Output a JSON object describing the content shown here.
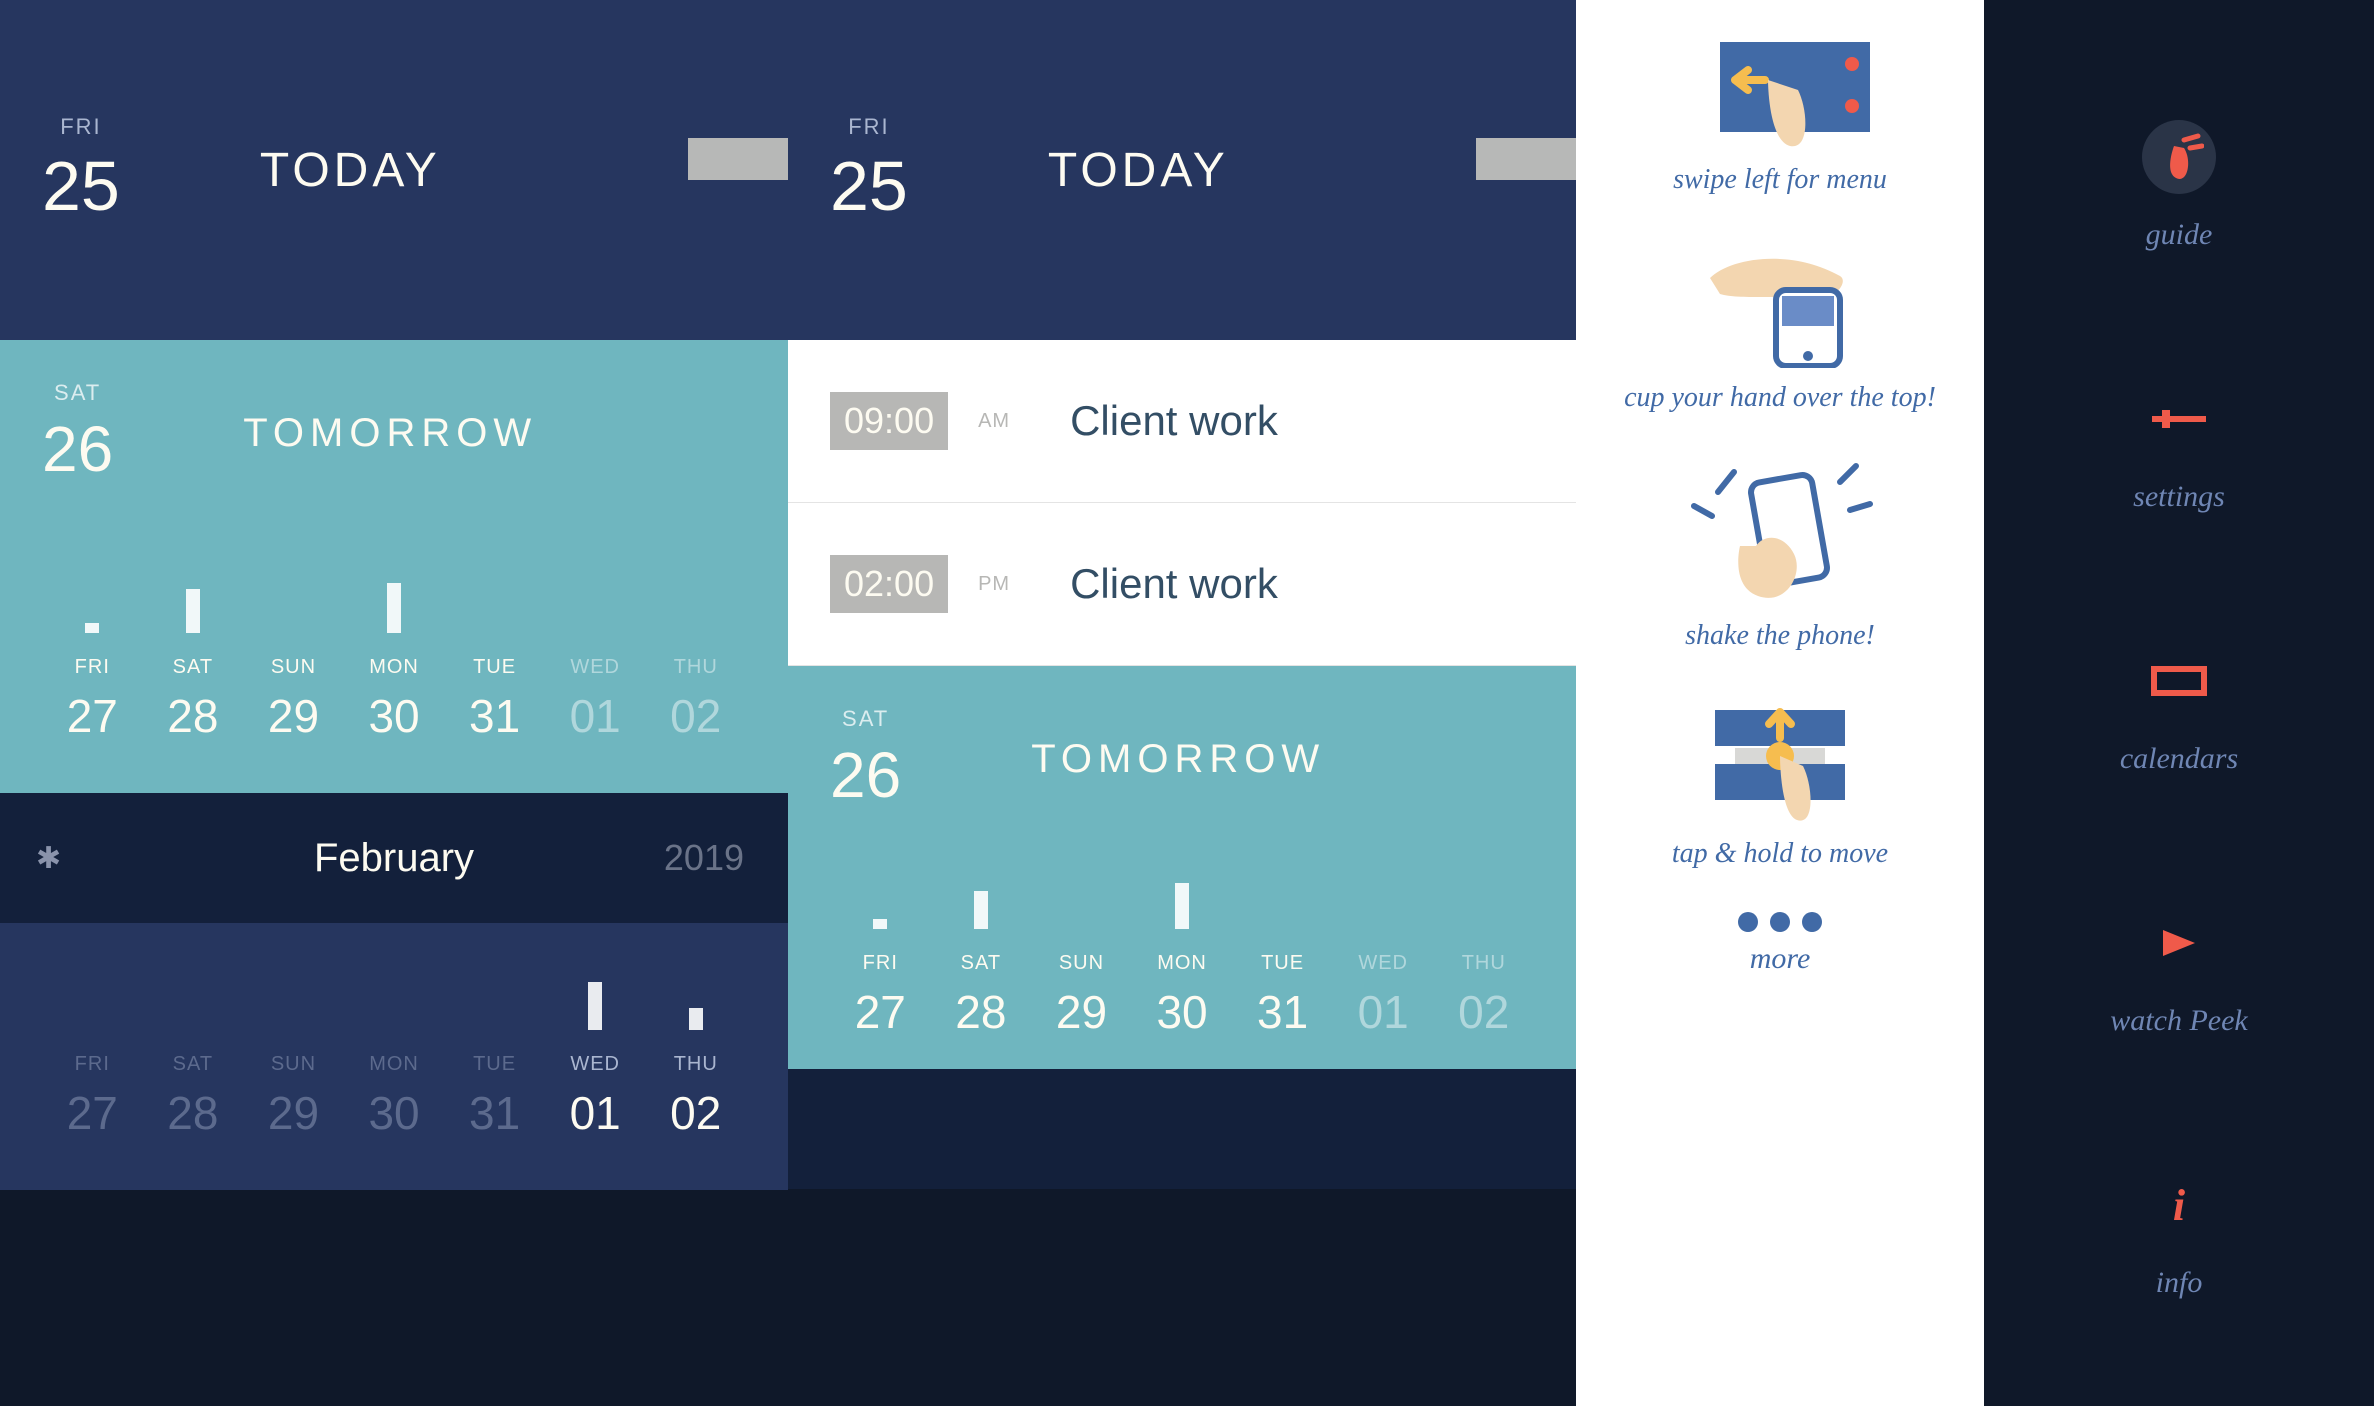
{
  "today": {
    "dow": "FRI",
    "num": "25",
    "label": "TODAY"
  },
  "tomorrow": {
    "dow": "SAT",
    "num": "26",
    "label": "TOMORROW"
  },
  "week1": [
    {
      "dow": "FRI",
      "num": "27",
      "dim": false,
      "bar": 10
    },
    {
      "dow": "SAT",
      "num": "28",
      "dim": false,
      "bar": 44
    },
    {
      "dow": "SUN",
      "num": "29",
      "dim": false,
      "bar": 0
    },
    {
      "dow": "MON",
      "num": "30",
      "dim": false,
      "bar": 50
    },
    {
      "dow": "TUE",
      "num": "31",
      "dim": false,
      "bar": 0
    },
    {
      "dow": "WED",
      "num": "01",
      "dim": true,
      "bar": 0
    },
    {
      "dow": "THU",
      "num": "02",
      "dim": true,
      "bar": 0
    }
  ],
  "month": {
    "name": "February",
    "year": "2019"
  },
  "week2": [
    {
      "dow": "FRI",
      "num": "27",
      "dim": true,
      "bar": 0
    },
    {
      "dow": "SAT",
      "num": "28",
      "dim": true,
      "bar": 0
    },
    {
      "dow": "SUN",
      "num": "29",
      "dim": true,
      "bar": 0
    },
    {
      "dow": "MON",
      "num": "30",
      "dim": true,
      "bar": 0
    },
    {
      "dow": "TUE",
      "num": "31",
      "dim": true,
      "bar": 0
    },
    {
      "dow": "WED",
      "num": "01",
      "dim": false,
      "bar": 48
    },
    {
      "dow": "THU",
      "num": "02",
      "dim": false,
      "bar": 22
    }
  ],
  "events": [
    {
      "time": "09:00",
      "ampm": "AM",
      "title": "Client work"
    },
    {
      "time": "02:00",
      "ampm": "PM",
      "title": "Client work"
    }
  ],
  "week3": [
    {
      "dow": "FRI",
      "num": "27",
      "dim": false,
      "bar": 10
    },
    {
      "dow": "SAT",
      "num": "28",
      "dim": false,
      "bar": 38
    },
    {
      "dow": "SUN",
      "num": "29",
      "dim": false,
      "bar": 0
    },
    {
      "dow": "MON",
      "num": "30",
      "dim": false,
      "bar": 46
    },
    {
      "dow": "TUE",
      "num": "31",
      "dim": false,
      "bar": 0
    },
    {
      "dow": "WED",
      "num": "01",
      "dim": true,
      "bar": 0
    },
    {
      "dow": "THU",
      "num": "02",
      "dim": true,
      "bar": 0
    }
  ],
  "guide": {
    "items": [
      "swipe left for menu",
      "cup your hand over the top!",
      "shake the phone!",
      "tap & hold to move"
    ],
    "more": "more"
  },
  "menu": {
    "guide": "guide",
    "settings": "settings",
    "calendars": "calendars",
    "watch": "watch Peek",
    "info": "info"
  }
}
